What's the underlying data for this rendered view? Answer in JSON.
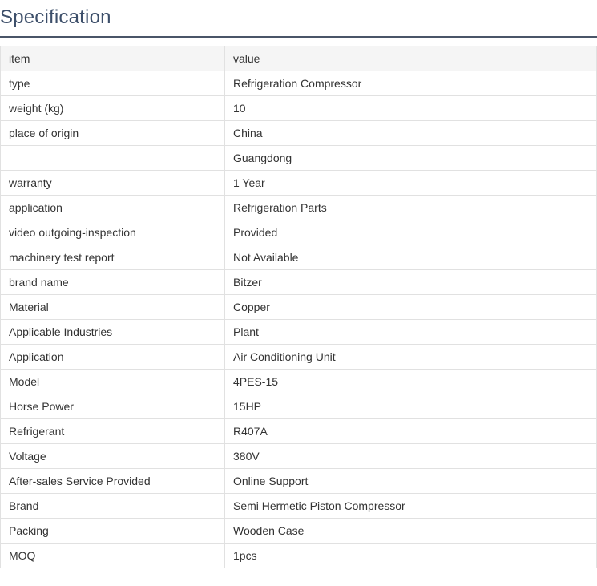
{
  "section": {
    "title": "Specification"
  },
  "table": {
    "header": {
      "item": "item",
      "value": "value"
    },
    "rows": [
      {
        "item": "type",
        "value": "Refrigeration Compressor"
      },
      {
        "item": "weight (kg)",
        "value": "10"
      },
      {
        "item": "place of origin",
        "value": "China"
      },
      {
        "item": "",
        "value": "Guangdong"
      },
      {
        "item": "warranty",
        "value": "1 Year"
      },
      {
        "item": "application",
        "value": "Refrigeration Parts"
      },
      {
        "item": "video outgoing-inspection",
        "value": "Provided"
      },
      {
        "item": "machinery test report",
        "value": "Not Available"
      },
      {
        "item": "brand name",
        "value": "Bitzer"
      },
      {
        "item": "Material",
        "value": "Copper"
      },
      {
        "item": "Applicable Industries",
        "value": "Plant"
      },
      {
        "item": "Application",
        "value": "Air Conditioning Unit"
      },
      {
        "item": "Model",
        "value": "4PES-15"
      },
      {
        "item": "Horse Power",
        "value": "15HP"
      },
      {
        "item": "Refrigerant",
        "value": "R407A"
      },
      {
        "item": "Voltage",
        "value": "380V"
      },
      {
        "item": "After-sales Service Provided",
        "value": "Online Support"
      },
      {
        "item": "Brand",
        "value": "Semi Hermetic Piston Compressor"
      },
      {
        "item": "Packing",
        "value": "Wooden Case"
      },
      {
        "item": "MOQ",
        "value": "1pcs"
      }
    ]
  }
}
